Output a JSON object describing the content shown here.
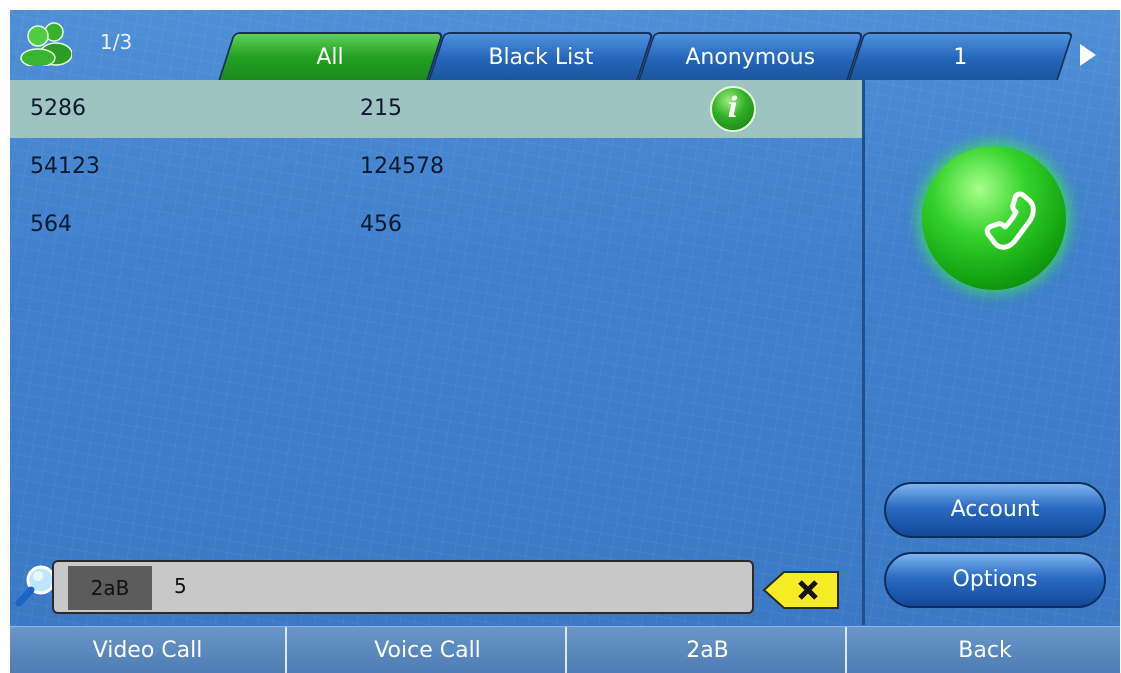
{
  "header": {
    "page_indicator": "1/3",
    "tabs": [
      {
        "label": "All",
        "active": true
      },
      {
        "label": "Black List",
        "active": false
      },
      {
        "label": "Anonymous",
        "active": false
      },
      {
        "label": "1",
        "active": false
      }
    ]
  },
  "list": {
    "rows": [
      {
        "name": "5286",
        "number": "215",
        "selected": true
      },
      {
        "name": "54123",
        "number": "124578",
        "selected": false
      },
      {
        "name": "564",
        "number": "456",
        "selected": false
      }
    ]
  },
  "side": {
    "account_label": "Account",
    "options_label": "Options"
  },
  "search": {
    "mode": "2aB",
    "value": "5"
  },
  "softkeys": [
    "Video Call",
    "Voice Call",
    "2aB",
    "Back"
  ],
  "colors": {
    "accent_green": "#23a022",
    "tab_blue": "#2465b8",
    "selected_row": "#9ec4c2",
    "background": "#3f7fcc"
  },
  "icons": [
    "contacts-icon",
    "info-icon",
    "phone-handset-icon",
    "search-icon",
    "clear-input-icon",
    "next-arrow-icon"
  ]
}
